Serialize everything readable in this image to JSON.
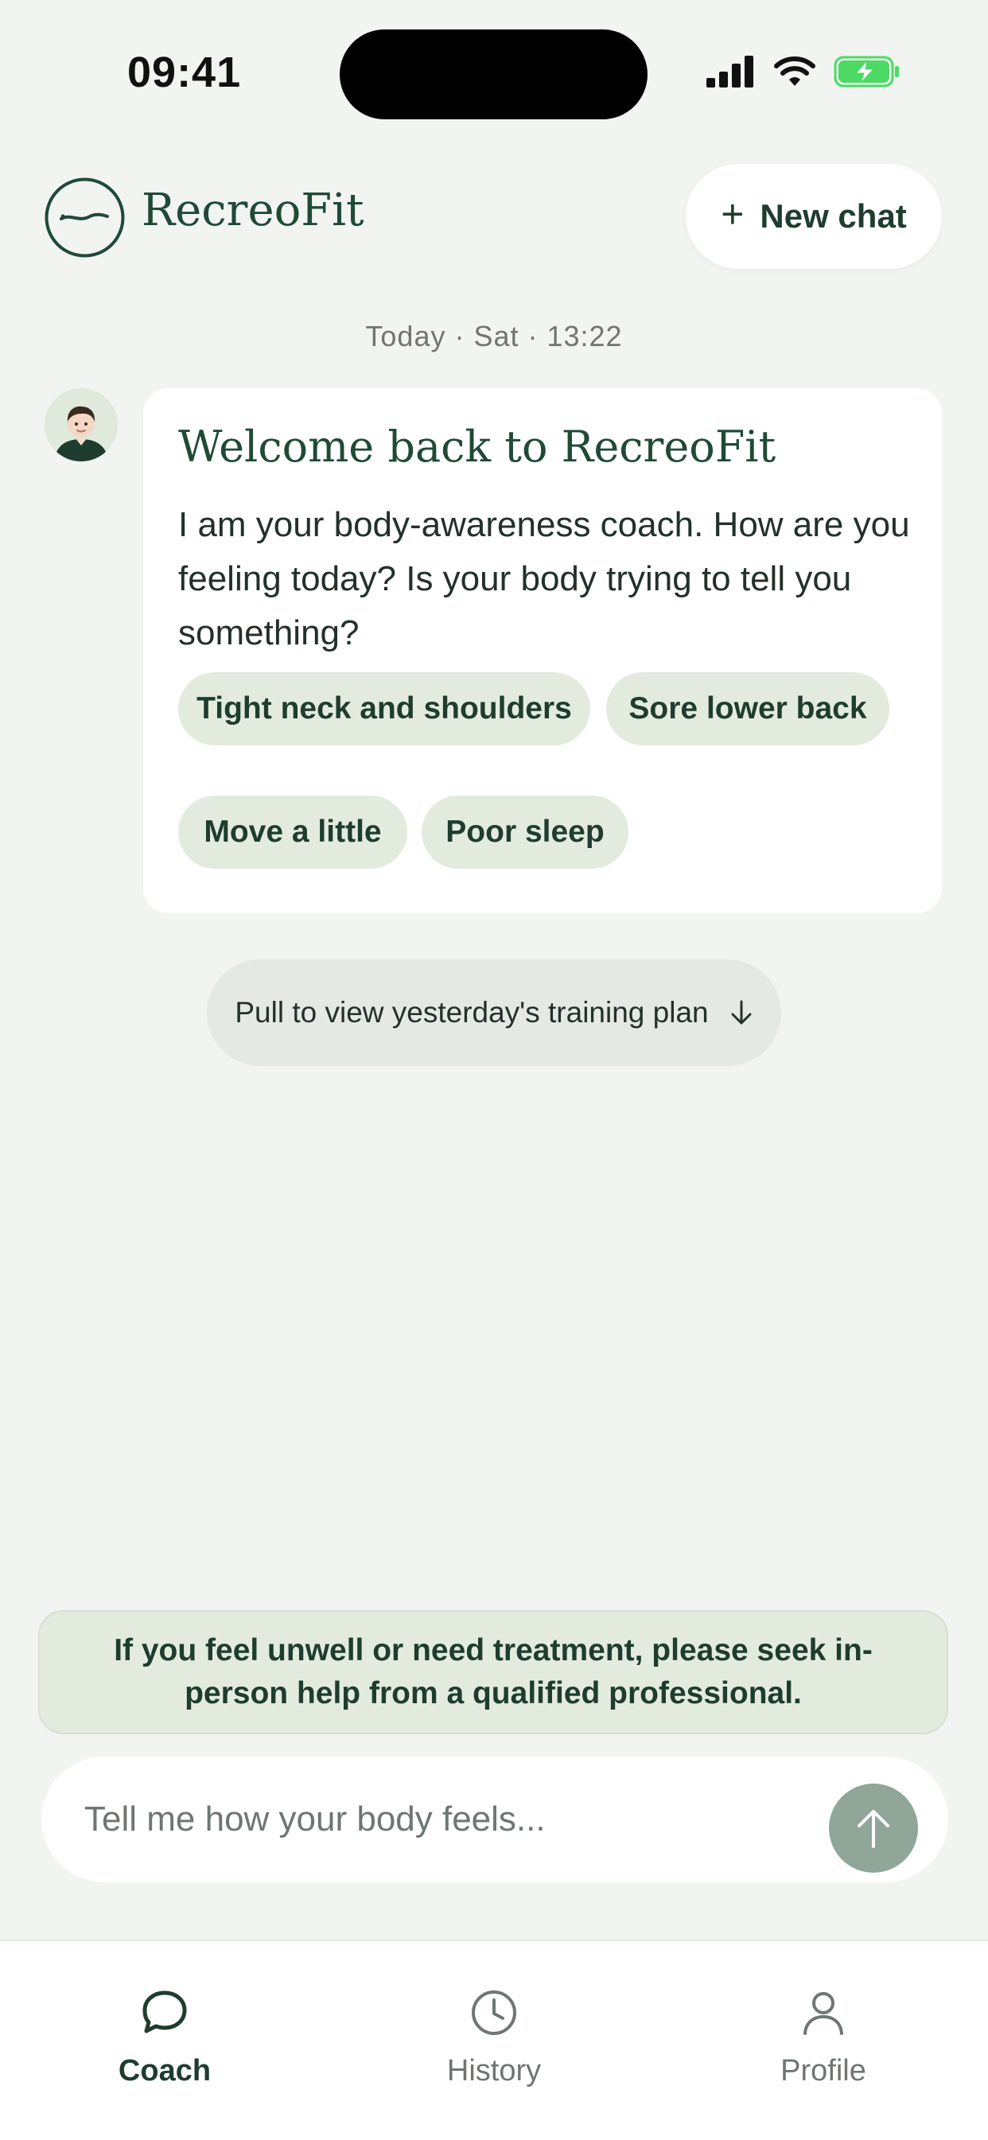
{
  "status_bar": {
    "time": "09:41"
  },
  "header": {
    "brand": "RecreoFit",
    "new_chat_label": "New chat"
  },
  "chat": {
    "date_stamp": "Today · Sat · 13:22",
    "message": {
      "title": "Welcome back to RecreoFit",
      "text": "I am your body-awareness coach. How are you feeling today? Is your body trying to tell you something?",
      "chips": [
        "Tight neck and shoulders",
        "Sore lower back",
        "Move a little",
        "Poor sleep"
      ]
    },
    "pull_hint": "Pull to view yesterday's training plan"
  },
  "disclaimer": "If you feel unwell or need treatment, please seek in-person help from a qualified professional.",
  "composer": {
    "placeholder": "Tell me how your body feels..."
  },
  "tabs": [
    {
      "label": "Coach",
      "icon": "chat-bubble-icon",
      "active": true
    },
    {
      "label": "History",
      "icon": "clock-icon",
      "active": false
    },
    {
      "label": "Profile",
      "icon": "person-icon",
      "active": false
    }
  ],
  "colors": {
    "background": "#f2f4f1",
    "brand_green": "#1f4a36",
    "chip_bg": "#e3ebdf",
    "send_button": "#8fa699",
    "battery_green": "#4cd964"
  }
}
